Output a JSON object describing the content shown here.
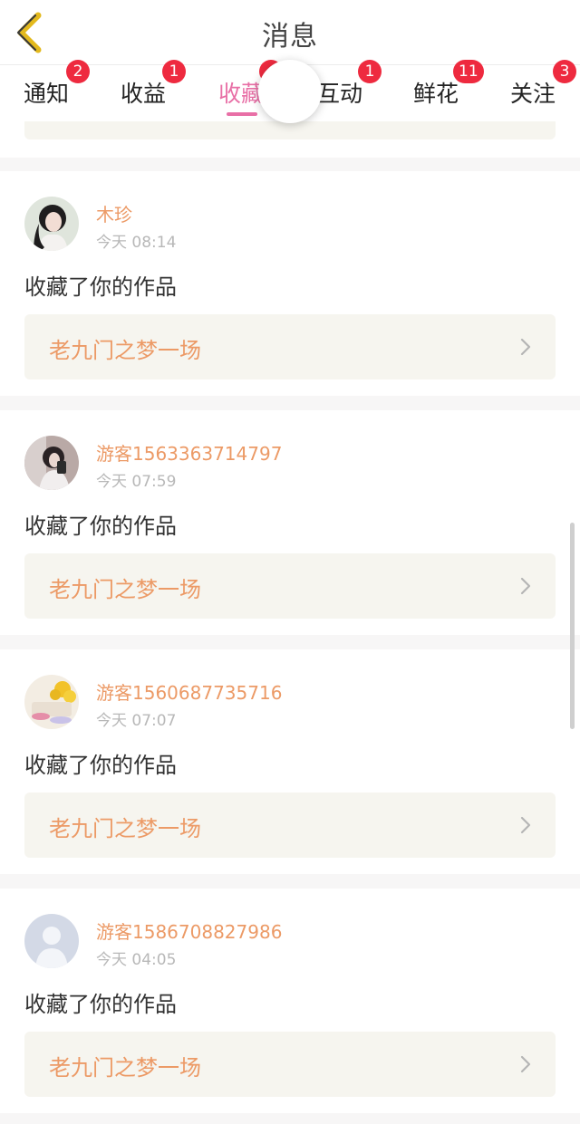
{
  "header": {
    "title": "消息"
  },
  "tabs": [
    {
      "label": "通知",
      "badge": "2"
    },
    {
      "label": "收益",
      "badge": "1"
    },
    {
      "label": "收藏",
      "badge": ""
    },
    {
      "label": "互动",
      "badge": "1"
    },
    {
      "label": "鲜花",
      "badge": "11"
    },
    {
      "label": "关注",
      "badge": "3"
    }
  ],
  "active_tab": "收藏",
  "messages": [
    {
      "user": "木珍",
      "time": "今天 08:14",
      "action": "收藏了你的作品",
      "work": "老九门之梦一场",
      "avatar": "photo-girl-dark-hair-icon"
    },
    {
      "user": "游客1563363714797",
      "time": "今天 07:59",
      "action": "收藏了你的作品",
      "work": "老九门之梦一场",
      "avatar": "photo-girl-mirror-icon"
    },
    {
      "user": "游客1560687735716",
      "time": "今天 07:07",
      "action": "收藏了你的作品",
      "work": "老九门之梦一场",
      "avatar": "photo-flowers-icon"
    },
    {
      "user": "游客1586708827986",
      "time": "今天 04:05",
      "action": "收藏了你的作品",
      "work": "老九门之梦一场",
      "avatar": "default-user-icon"
    }
  ],
  "colors": {
    "accent_pink": "#e86fa6",
    "name_orange": "#ec9a66",
    "badge_red": "#ee2a3f",
    "back_yellow": "#e3b91d"
  }
}
